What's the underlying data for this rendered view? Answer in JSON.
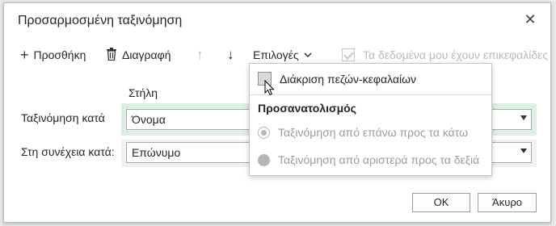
{
  "dialog": {
    "title": "Προσαρμοσμένη ταξινόμηση",
    "close_icon": "close-icon"
  },
  "toolbar": {
    "add_label": "Προσθήκη",
    "delete_label": "Διαγραφή",
    "options_label": "Επιλογές",
    "headers_label": "Τα δεδομένα μου έχουν επικεφαλίδες",
    "headers_checked": true
  },
  "sort": {
    "column_header": "Στήλη",
    "rows": [
      {
        "label": "Ταξινόμηση κατά",
        "value": "Όνομα"
      },
      {
        "label": "Στη συνέχεια κατά:",
        "value": "Επώνυμο"
      }
    ]
  },
  "options_menu": {
    "case_sensitive_label": "Διάκριση πεζών-κεφαλαίων",
    "orientation_header": "Προσανατολισμός",
    "top_to_bottom_label": "Ταξινόμηση από επάνω προς τα κάτω",
    "left_to_right_label": "Ταξινόμηση από αριστερά προς τα δεξιά",
    "selected_orientation": "top-to-bottom"
  },
  "footer": {
    "ok_label": "ΟΚ",
    "cancel_label": "Άκυρο"
  },
  "colors": {
    "selected_row_bg": "#dcefe3",
    "disabled_text": "#b9b9b9"
  }
}
